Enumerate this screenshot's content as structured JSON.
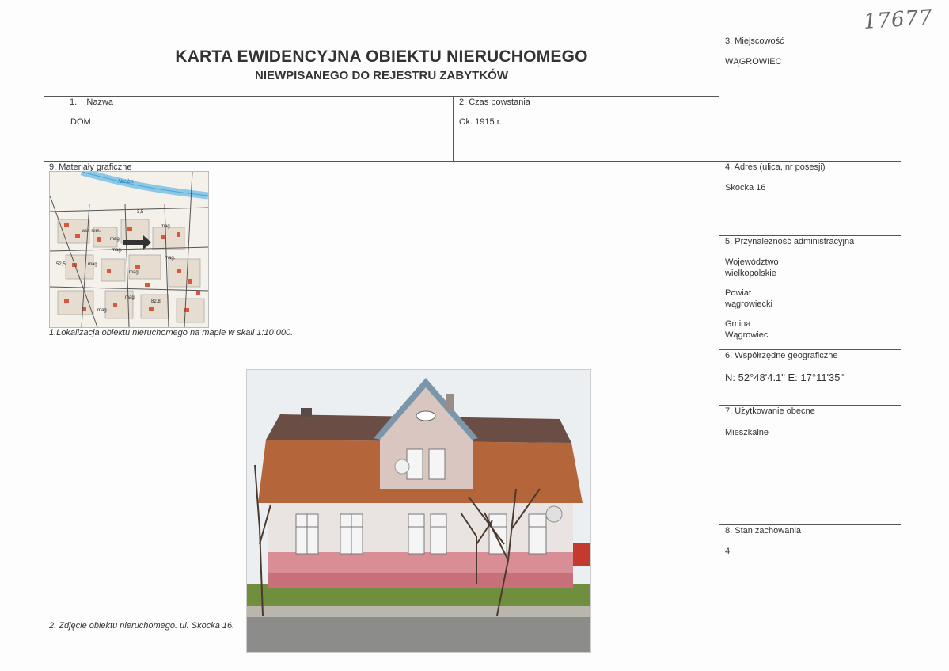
{
  "stamp_number": "17677",
  "header": {
    "title": "KARTA EWIDENCYJNA OBIEKTU NIERUCHOMEGO",
    "subtitle": "NIEWPISANEGO DO REJESTRU ZABYTKÓW"
  },
  "fields": {
    "nazwa": {
      "label": "1.    Nazwa",
      "value": "DOM"
    },
    "czas": {
      "label": "2. Czas powstania",
      "value": "Ok. 1915 r."
    },
    "miejscowosc": {
      "label": "3. Miejscowość",
      "value": "WĄGROWIEC"
    },
    "adres": {
      "label": "4. Adres (ulica, nr posesji)",
      "value": "Skocka 16"
    },
    "przynaleznosc": {
      "label": "5. Przynależność administracyjna",
      "wojewodztwo_label": "Województwo",
      "wojewodztwo_value": "wielkopolskie",
      "powiat_label": "Powiat",
      "powiat_value": "wągrowiecki",
      "gmina_label": "Gmina",
      "gmina_value": "Wągrowiec"
    },
    "wspolrzedne": {
      "label": "6. Współrzędne geograficzne",
      "value": "N: 52°48'4.1\"  E: 17°11'35\""
    },
    "uzytkowanie": {
      "label": "7. Użytkowanie obecne",
      "value": "Mieszkalne"
    },
    "stan": {
      "label": "8. Stan zachowania",
      "value": "4"
    },
    "materialy": {
      "label": "9. Materiały graficzne"
    }
  },
  "map": {
    "river_label": "Nielba",
    "labels": [
      "wsr. rem.",
      "mag.",
      "mag.",
      "mag.",
      "mag.",
      "mag.",
      "mag.",
      "mag.",
      "mag."
    ],
    "heights": [
      "52,5",
      "82,8",
      "3,5"
    ]
  },
  "captions": {
    "map": "1.Lokalizacja obiektu nieruchomego na mapie w skali 1:10 000.",
    "photo": "2. Zdjęcie obiektu nieruchomego. ul. Skocka 16."
  },
  "colors": {
    "roof": "#b5653a",
    "roof_dark": "#6a4d45",
    "wall_light": "#e9e3e2",
    "wall_pink": "#d98e95",
    "grass": "#6f8f3e"
  }
}
